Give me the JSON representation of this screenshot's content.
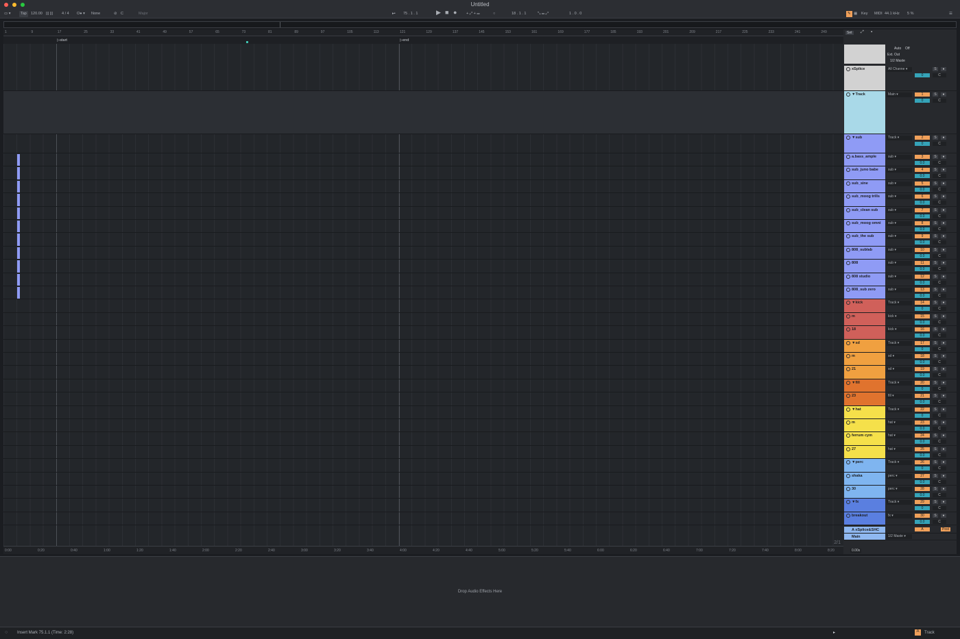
{
  "window": {
    "title": "Untitled"
  },
  "transport": {
    "tap": "Tap",
    "tempo": "120.00",
    "signature": "4 / 4",
    "metronome": "1 Bar",
    "quantize": "None",
    "scale_root": "C",
    "scale_mode": "Major",
    "position": "75 .  1 .  1",
    "loop_start": "18 .  1 .  1",
    "loop_length": "1 .  0 .  0",
    "key_label": "Key",
    "midi_label": "MIDI",
    "sample_rate": "44.1 kHz",
    "cpu": "5 %"
  },
  "ruler_bars": [
    "1",
    "9",
    "17",
    "25",
    "33",
    "41",
    "49",
    "57",
    "65",
    "73",
    "81",
    "89",
    "97",
    "105",
    "113",
    "121",
    "129",
    "137",
    "145",
    "153",
    "161",
    "169",
    "177",
    "185",
    "193",
    "201",
    "209",
    "217",
    "225",
    "233",
    "241",
    "249"
  ],
  "locators": {
    "start": "start",
    "end": "end"
  },
  "time_labels": [
    "0:00",
    "0:20",
    "0:40",
    "1:00",
    "1:20",
    "1:40",
    "2:00",
    "2:20",
    "2:40",
    "3:00",
    "3:20",
    "3:40",
    "4:00",
    "4:20",
    "4:40",
    "5:00",
    "5:20",
    "5:40",
    "6:00",
    "6:20",
    "6:40",
    "7:00",
    "7:20",
    "7:40",
    "8:00",
    "8:20"
  ],
  "page_counter": "2/1",
  "mixer": {
    "set_label": "Set",
    "master_io": {
      "input_mode": "Auto",
      "input_state": "Off",
      "out_type": "Ext. Out",
      "out_channel": "1/2 Maste"
    },
    "tracks": [
      {
        "name": "xSplice",
        "color": "#d2d2d2",
        "io": "All Channe",
        "num": "",
        "vol": "0",
        "kind": "top"
      },
      {
        "name": "Track",
        "color": "#a9d9e8",
        "io": "Main",
        "num": "1",
        "vol": "0",
        "kind": "group"
      },
      {
        "name": "sub",
        "color": "#8f9bf5",
        "io": "Track",
        "num": "2",
        "vol": "0",
        "kind": "group"
      },
      {
        "name": "a.bass_ample",
        "color": "#8f9bf5",
        "io": "sub",
        "num": "3",
        "vol": "0.0"
      },
      {
        "name": "sub_juno babe",
        "color": "#8f9bf5",
        "io": "sub",
        "num": "4",
        "vol": "0.0"
      },
      {
        "name": "sub_sine",
        "color": "#8f9bf5",
        "io": "sub",
        "num": "5",
        "vol": "0.0"
      },
      {
        "name": "sub_moog trills",
        "color": "#8f9bf5",
        "io": "sub",
        "num": "6",
        "vol": "0.0"
      },
      {
        "name": "sub_clean sub",
        "color": "#8f9bf5",
        "io": "sub",
        "num": "7",
        "vol": "0.0"
      },
      {
        "name": "sub_moog omni",
        "color": "#8f9bf5",
        "io": "sub",
        "num": "8",
        "vol": "0.0"
      },
      {
        "name": "sub_the sub",
        "color": "#8f9bf5",
        "io": "sub",
        "num": "9",
        "vol": "0.0"
      },
      {
        "name": "808_sublab",
        "color": "#8f9bf5",
        "io": "sub",
        "num": "10",
        "vol": "0.0"
      },
      {
        "name": "808",
        "color": "#8f9bf5",
        "io": "sub",
        "num": "11",
        "vol": "0.0"
      },
      {
        "name": "808 studio",
        "color": "#8f9bf5",
        "io": "sub",
        "num": "12",
        "vol": "0.0"
      },
      {
        "name": "808_sub zero",
        "color": "#8f9bf5",
        "io": "sub",
        "num": "13",
        "vol": "0.0"
      },
      {
        "name": "kick",
        "color": "#d0605a",
        "io": "Track",
        "num": "14",
        "vol": "0",
        "kind": "group"
      },
      {
        "name": "m",
        "color": "#d0605a",
        "io": "kick",
        "num": "15",
        "vol": "0.0"
      },
      {
        "name": "18",
        "color": "#d0605a",
        "io": "kick",
        "num": "16",
        "vol": "0.0"
      },
      {
        "name": "sd",
        "color": "#f0a040",
        "io": "Track",
        "num": "17",
        "vol": "0",
        "kind": "group"
      },
      {
        "name": "m",
        "color": "#f0a040",
        "io": "sd",
        "num": "18",
        "vol": "0.0"
      },
      {
        "name": "21",
        "color": "#f0a040",
        "io": "sd",
        "num": "19",
        "vol": "0.0"
      },
      {
        "name": "fill",
        "color": "#e0732e",
        "io": "Track",
        "num": "20",
        "vol": "0",
        "kind": "group"
      },
      {
        "name": "23",
        "color": "#e0732e",
        "io": "fill",
        "num": "21",
        "vol": "0.0"
      },
      {
        "name": "hat",
        "color": "#f5e04a",
        "io": "Track",
        "num": "22",
        "vol": "0",
        "kind": "group"
      },
      {
        "name": "m",
        "color": "#f5e04a",
        "io": "hat",
        "num": "23",
        "vol": "0.0"
      },
      {
        "name": "ferrum cym",
        "color": "#f5e04a",
        "io": "hat",
        "num": "24",
        "vol": "0.0"
      },
      {
        "name": "27",
        "color": "#f5e04a",
        "io": "hat",
        "num": "25",
        "vol": "0.0"
      },
      {
        "name": "perc",
        "color": "#7fb5f0",
        "io": "Track",
        "num": "26",
        "vol": "0",
        "kind": "group"
      },
      {
        "name": "shaka",
        "color": "#7fb5f0",
        "io": "perc",
        "num": "27",
        "vol": "0.0"
      },
      {
        "name": "30",
        "color": "#7fb5f0",
        "io": "perc",
        "num": "28",
        "vol": "0.0"
      },
      {
        "name": "fx",
        "color": "#5a7fe0",
        "io": "Track",
        "num": "29",
        "vol": "0",
        "kind": "group"
      },
      {
        "name": "breakout",
        "color": "#5a7fe0",
        "io": "fx",
        "num": "30",
        "vol": "0.0"
      }
    ],
    "returns": [
      {
        "name": "A xSplice&SHC",
        "color": "#8fb8f0",
        "io": "",
        "num": "A",
        "post": "Post"
      },
      {
        "name": "Main",
        "color": "#8fb8f0",
        "io": "1/2 Maste",
        "num": "",
        "post": ""
      }
    ],
    "bottom_zoom": "0.00x"
  },
  "device_view": {
    "drop_text": "Drop Audio Effects Here"
  },
  "status": {
    "message": "Insert Mark 75.1.1 (Time: 2:28)",
    "current_track": "Track"
  }
}
